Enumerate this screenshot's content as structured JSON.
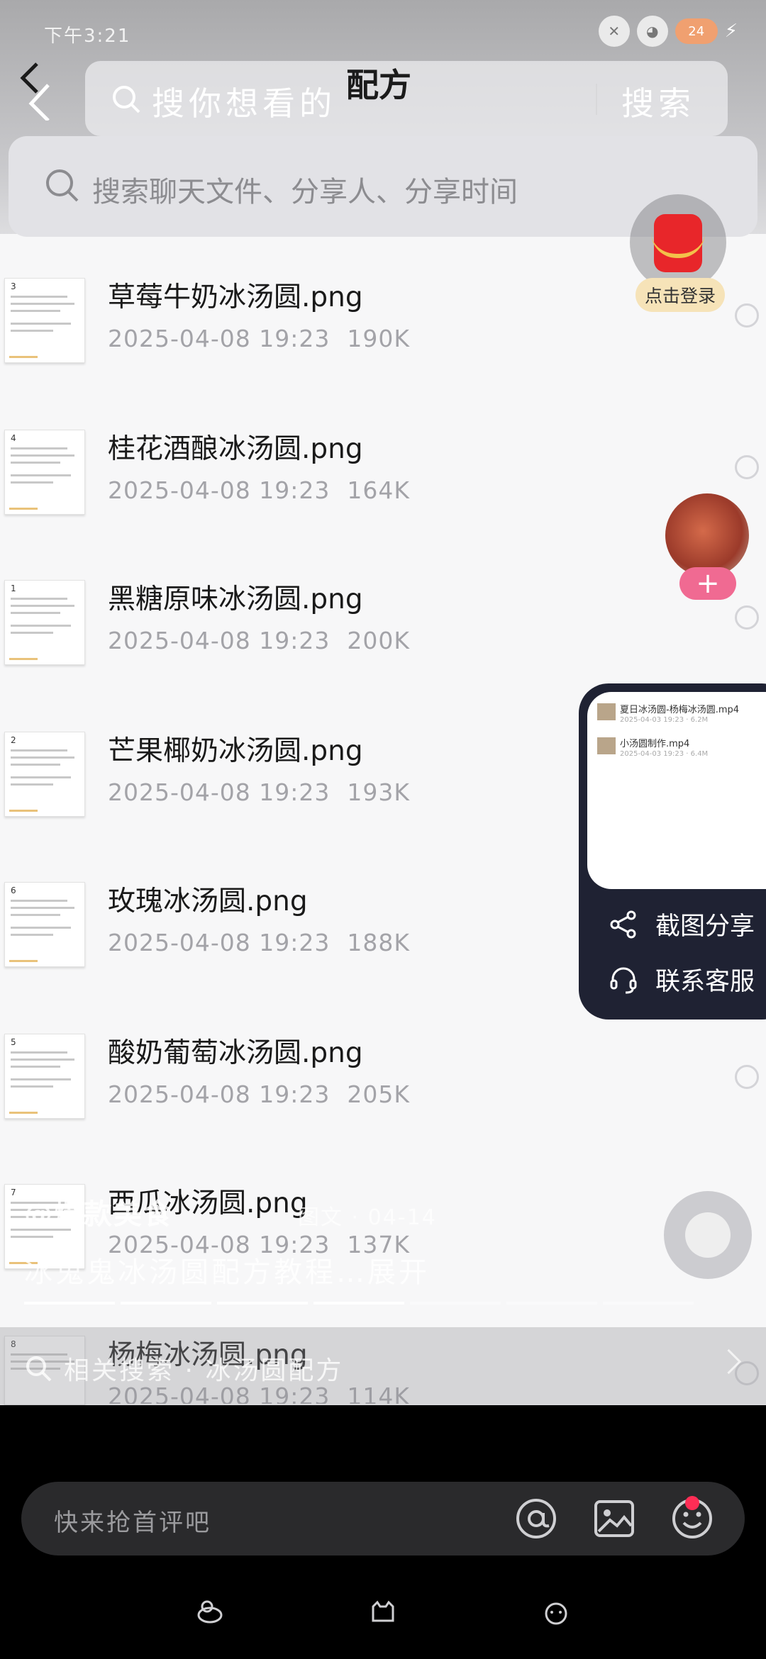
{
  "status_bar": {
    "time": "下午3:21",
    "battery": "24"
  },
  "header": {
    "search_placeholder": "搜你想看的",
    "title": "配方",
    "search_button": "搜索"
  },
  "chat_search": {
    "placeholder": "搜索聊天文件、分享人、分享时间"
  },
  "files": [
    {
      "name": "草莓牛奶冰汤圆.png",
      "date": "2025-04-08 19:23",
      "size": "190K",
      "thumb_num": "3"
    },
    {
      "name": "桂花酒酿冰汤圆.png",
      "date": "2025-04-08 19:23",
      "size": "164K",
      "thumb_num": "4"
    },
    {
      "name": "黑糖原味冰汤圆.png",
      "date": "2025-04-08 19:23",
      "size": "200K",
      "thumb_num": "1"
    },
    {
      "name": "芒果椰奶冰汤圆.png",
      "date": "2025-04-08 19:23",
      "size": "193K",
      "thumb_num": "2"
    },
    {
      "name": "玫瑰冰汤圆.png",
      "date": "2025-04-08 19:23",
      "size": "188K",
      "thumb_num": "6"
    },
    {
      "name": "酸奶葡萄冰汤圆.png",
      "date": "2025-04-08 19:23",
      "size": "205K",
      "thumb_num": "5"
    },
    {
      "name": "西瓜冰汤圆.png",
      "date": "2025-04-08 19:23",
      "size": "137K",
      "thumb_num": "7"
    },
    {
      "name": "杨梅冰汤圆.png",
      "date": "2025-04-08 19:23",
      "size": "114K",
      "thumb_num": "8"
    }
  ],
  "overlay": {
    "login_label": "点击登录",
    "follow_label": "+",
    "share_preview": [
      {
        "title": "夏日冰汤圆-杨梅冰汤圆.mp4",
        "meta": "2025-04-03 19:23 · 6.2M"
      },
      {
        "title": "小汤圆制作.mp4",
        "meta": "2025-04-03 19:23 · 6.4M"
      }
    ],
    "screenshot_share": "截图分享",
    "contact_support": "联系客服"
  },
  "video": {
    "author": "@爆款美食",
    "date_info": "图文 · 04-14",
    "description": "冰鬼鬼冰汤圆配方教程…展开",
    "related_search": "相关搜索 · 冰汤圆配方"
  },
  "comment": {
    "placeholder": "快来抢首评吧"
  }
}
